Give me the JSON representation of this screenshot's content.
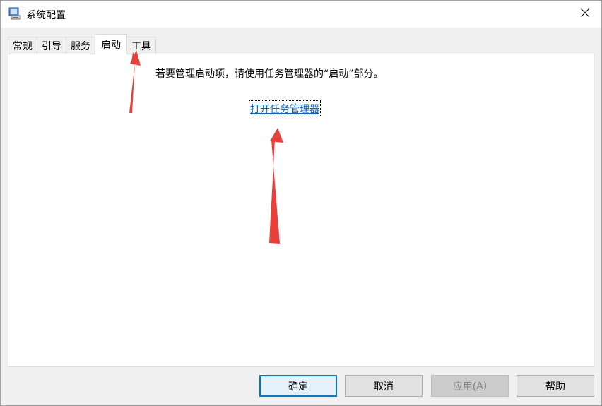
{
  "window": {
    "title": "系统配置",
    "icon": "msconfig-computer-icon",
    "close_icon": "close-icon"
  },
  "tabs": [
    {
      "label": "常规",
      "active": false
    },
    {
      "label": "引导",
      "active": false
    },
    {
      "label": "服务",
      "active": false
    },
    {
      "label": "启动",
      "active": true
    },
    {
      "label": "工具",
      "active": false
    }
  ],
  "startup_panel": {
    "info_text": "若要管理启动项，请使用任务管理器的“启动”部分。",
    "link_text": "打开任务管理器"
  },
  "buttons": {
    "ok": "确定",
    "cancel": "取消",
    "apply_prefix": "应用(",
    "apply_mnemonic": "A",
    "apply_suffix": ")",
    "help": "帮助"
  },
  "colors": {
    "link": "#0066cc",
    "annotation_arrow": "#e8413c",
    "default_button_border": "#0078d7"
  }
}
